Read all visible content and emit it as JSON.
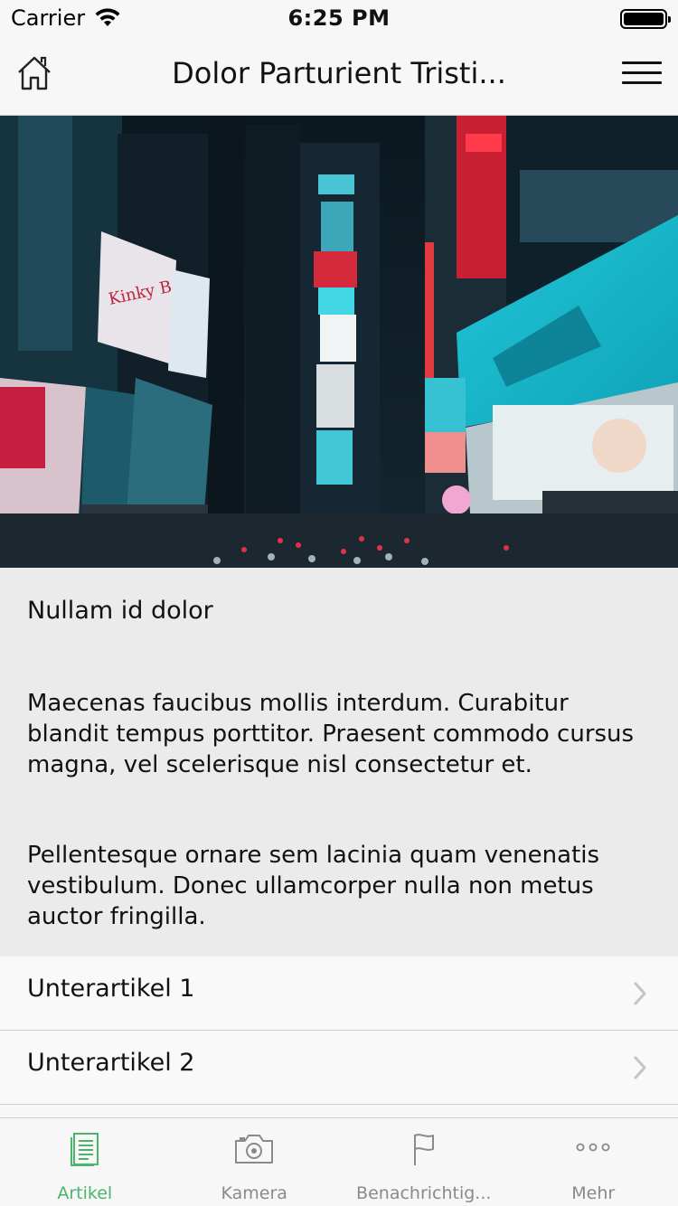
{
  "status_bar": {
    "carrier": "Carrier",
    "time": "6:25 PM"
  },
  "nav": {
    "title": "Dolor Parturient Tristi..."
  },
  "article": {
    "heading": "Nullam id dolor",
    "paragraph_1": "Maecenas faucibus mollis interdum. Curabitur blandit tempus porttitor. Praesent commodo cursus magna, vel scelerisque nisl consectetur et.",
    "paragraph_2": "Pellentesque ornare sem lacinia quam venenatis vestibulum. Donec ullamcorper nulla non metus auctor fringilla."
  },
  "sub_items": [
    {
      "label": "Unterartikel 1"
    },
    {
      "label": "Unterartikel 2"
    }
  ],
  "tabs": [
    {
      "label": "Artikel",
      "icon": "article-icon",
      "active": true
    },
    {
      "label": "Kamera",
      "icon": "camera-icon",
      "active": false
    },
    {
      "label": "Benachrichtig...",
      "icon": "flag-icon",
      "active": false
    },
    {
      "label": "Mehr",
      "icon": "more-icon",
      "active": false
    }
  ],
  "colors": {
    "accent": "#4cb56c",
    "tab_inactive": "#8a8a8a",
    "article_background": "#ebebeb",
    "bar_background": "#f7f7f7"
  }
}
